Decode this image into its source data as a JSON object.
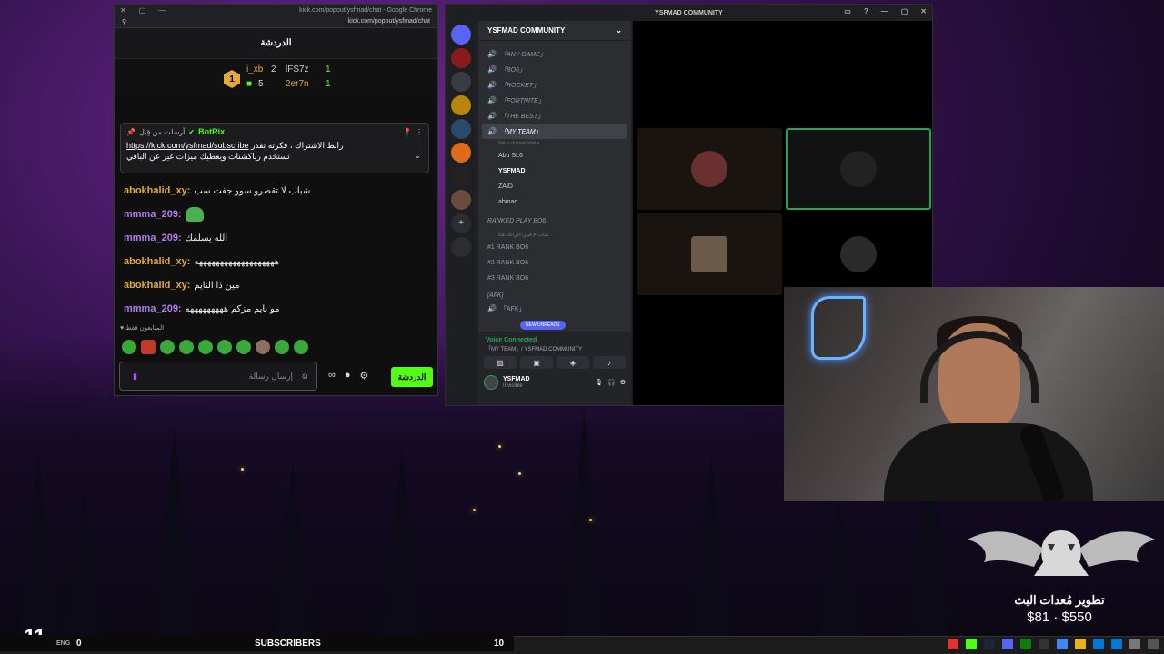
{
  "chrome": {
    "title": "kick.com/popout/ysfmad/chat - Google Chrome",
    "url": "kick.com/popout/ysfmad/chat"
  },
  "kick": {
    "header": "الدردشة",
    "leaderboard": {
      "rank1": "1",
      "user1": "i_xb",
      "count1": "5",
      "rank2": "2",
      "user2": "lFS7z",
      "count2": "1",
      "user3": "2er7n",
      "count3": "1"
    },
    "pinned": {
      "sent_by": "أرسلت من قِبل",
      "bot": "BotRix",
      "line1_link": "https://kick.com/ysfmad/subscribe",
      "line1_text": "رابط الاشتراك ، فكرته تقدر",
      "line2_text": "تستخدم رياكشنات ويعطيك ميزات غير عن الباقي"
    },
    "messages": [
      {
        "user": "abokhalid_xy:",
        "text": "شباب لا تقصرو سوو جفت سب"
      },
      {
        "user": "mmma_209:",
        "text": ""
      },
      {
        "user": "mmma_209:",
        "text": "الله يسلمك"
      },
      {
        "user": "abokhalid_xy:",
        "text": "هههههههههههههههههههه"
      },
      {
        "user": "abokhalid_xy:",
        "text": "مين ذا النايم"
      },
      {
        "user": "mmma_209:",
        "text": "مو نايم مزكم هههههههههه"
      }
    ],
    "followers_only": "المتابعون فقط",
    "input_placeholder": "إرسال رسالة",
    "send_label": "الدردشة"
  },
  "discord": {
    "title": "YSFMAD COMMUNITY",
    "server_name": "YSFMAD COMMUNITY",
    "channels": [
      {
        "name": "「ANY GAME」"
      },
      {
        "name": "「BO6」"
      },
      {
        "name": "「ROCKET」"
      },
      {
        "name": "「FORTNITE」"
      },
      {
        "name": "「THE BEST」"
      },
      {
        "name": "「MY TEAM」"
      }
    ],
    "channel_status": "Set a channel status",
    "members": [
      "Abu SL6",
      "YSFMAD",
      "ZAID",
      "ahmad"
    ],
    "category": "RANKED PLAY BO6",
    "subtitle": "شات-لاعبين-الرانك-هنا",
    "rank_channels": [
      "#1 RANK BO6",
      "#2 RANK BO6",
      "#3 RANK BO6"
    ],
    "afk_category": "[AFK]",
    "afk_channel": "「AFK」",
    "new_unreads": "NEW UNREADS",
    "voice_connected": "Voice Connected",
    "voice_channel": "「MY TEAM」/ YSFMAD COMMUNITY",
    "user": "YSFMAD",
    "user_status": "Invisible"
  },
  "goal": {
    "title": "تطوير مُعدات البث",
    "amount": "$81 · $550"
  },
  "taskbar": {
    "big_number": "11",
    "followers_count": "0",
    "subscribers_label": "SUBSCRIBERS",
    "subscribers_count": "10",
    "lang": "ENG"
  }
}
